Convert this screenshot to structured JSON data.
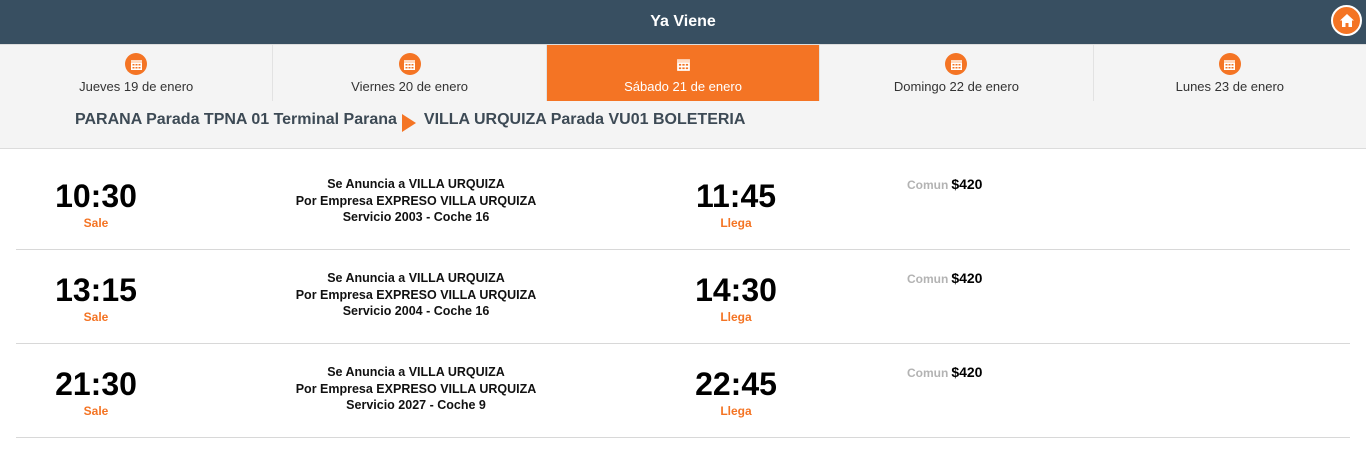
{
  "header": {
    "title": "Ya Viene",
    "home_icon": "home-icon"
  },
  "colors": {
    "accent": "#f47424",
    "header_bg": "#384f61",
    "bar_bg": "#f4f4f4"
  },
  "days": [
    {
      "label": "Jueves 19 de enero",
      "active": false,
      "icon": "calendar-icon"
    },
    {
      "label": "Viernes 20 de enero",
      "active": false,
      "icon": "calendar-icon"
    },
    {
      "label": "Sábado 21 de enero",
      "active": true,
      "icon": "calendar-icon"
    },
    {
      "label": "Domingo 22 de enero",
      "active": false,
      "icon": "calendar-icon"
    },
    {
      "label": "Lunes 23 de enero",
      "active": false,
      "icon": "calendar-icon"
    }
  ],
  "route": {
    "origin": "PARANA Parada TPNA 01 Terminal Parana",
    "destination": "VILLA URQUIZA Parada VU01 BOLETERIA"
  },
  "trips": [
    {
      "depart": "10:30",
      "depart_label": "Sale",
      "line1": "Se Anuncia a VILLA URQUIZA",
      "line2": "Por Empresa EXPRESO VILLA URQUIZA",
      "line3": "Servicio 2003 - Coche 16",
      "arrive": "11:45",
      "arrive_label": "Llega",
      "fare_type": "Comun",
      "price": "$420"
    },
    {
      "depart": "13:15",
      "depart_label": "Sale",
      "line1": "Se Anuncia a VILLA URQUIZA",
      "line2": "Por Empresa EXPRESO VILLA URQUIZA",
      "line3": "Servicio 2004 - Coche 16",
      "arrive": "14:30",
      "arrive_label": "Llega",
      "fare_type": "Comun",
      "price": "$420"
    },
    {
      "depart": "21:30",
      "depart_label": "Sale",
      "line1": "Se Anuncia a VILLA URQUIZA",
      "line2": "Por Empresa EXPRESO VILLA URQUIZA",
      "line3": "Servicio 2027 - Coche 9",
      "arrive": "22:45",
      "arrive_label": "Llega",
      "fare_type": "Comun",
      "price": "$420"
    }
  ]
}
